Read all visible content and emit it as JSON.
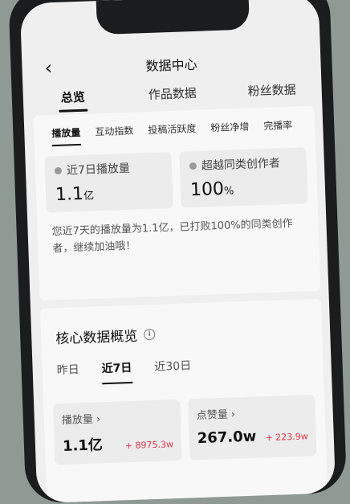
{
  "header": {
    "back_icon": "chevron-left-icon",
    "back_glyph": "‹",
    "title": "数据中心"
  },
  "top_tabs": [
    {
      "label": "总览",
      "active": true
    },
    {
      "label": "作品数据",
      "active": false
    },
    {
      "label": "粉丝数据",
      "active": false
    }
  ],
  "sub_tabs": [
    "播放量",
    "互动指数",
    "投稿活跃度",
    "粉丝净增",
    "完播率"
  ],
  "stats": [
    {
      "label": "近7日播放量",
      "value": "1.1",
      "unit": "亿"
    },
    {
      "label": "超越同类创作者",
      "value": "100",
      "unit": "%"
    }
  ],
  "summary": "您近7天的播放量为1.1亿，已打败100%的同类创作者，继续加油哦！",
  "core": {
    "title": "核心数据概览",
    "info_glyph": "i",
    "periods": [
      "昨日",
      "近7日",
      "近30日"
    ],
    "metrics": [
      {
        "label": "播放量 ›",
        "value": "1.1亿",
        "change": "+ 8975.3w"
      },
      {
        "label": "点赞量 ›",
        "value": "267.0w",
        "change": "+ 223.9w"
      }
    ]
  },
  "colors": {
    "positive": "#e0344a",
    "background": "#efefef"
  }
}
